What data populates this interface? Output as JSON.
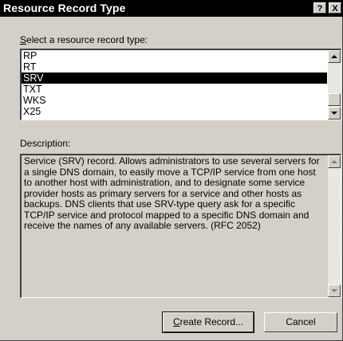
{
  "window": {
    "title": "Resource Record Type",
    "help_label": "?",
    "close_label": "X"
  },
  "select_label": {
    "accel": "S",
    "rest": "elect a resource record type:"
  },
  "record_types": {
    "items": [
      "RP",
      "RT",
      "SRV",
      "TXT",
      "WKS",
      "X25"
    ],
    "selected": "SRV"
  },
  "description": {
    "label": "Description:",
    "text": "Service (SRV) record. Allows administrators to use several servers for a single DNS domain, to easily move a TCP/IP service from one host to another host with administration, and to designate some service provider hosts as primary servers for a service and other hosts as backups. DNS clients that use SRV-type query ask for a specific TCP/IP service and protocol mapped to a specific DNS domain and receive the names of any available servers. (RFC 2052)"
  },
  "buttons": {
    "create_accel": "C",
    "create_rest": "reate Record...",
    "cancel": "Cancel"
  }
}
